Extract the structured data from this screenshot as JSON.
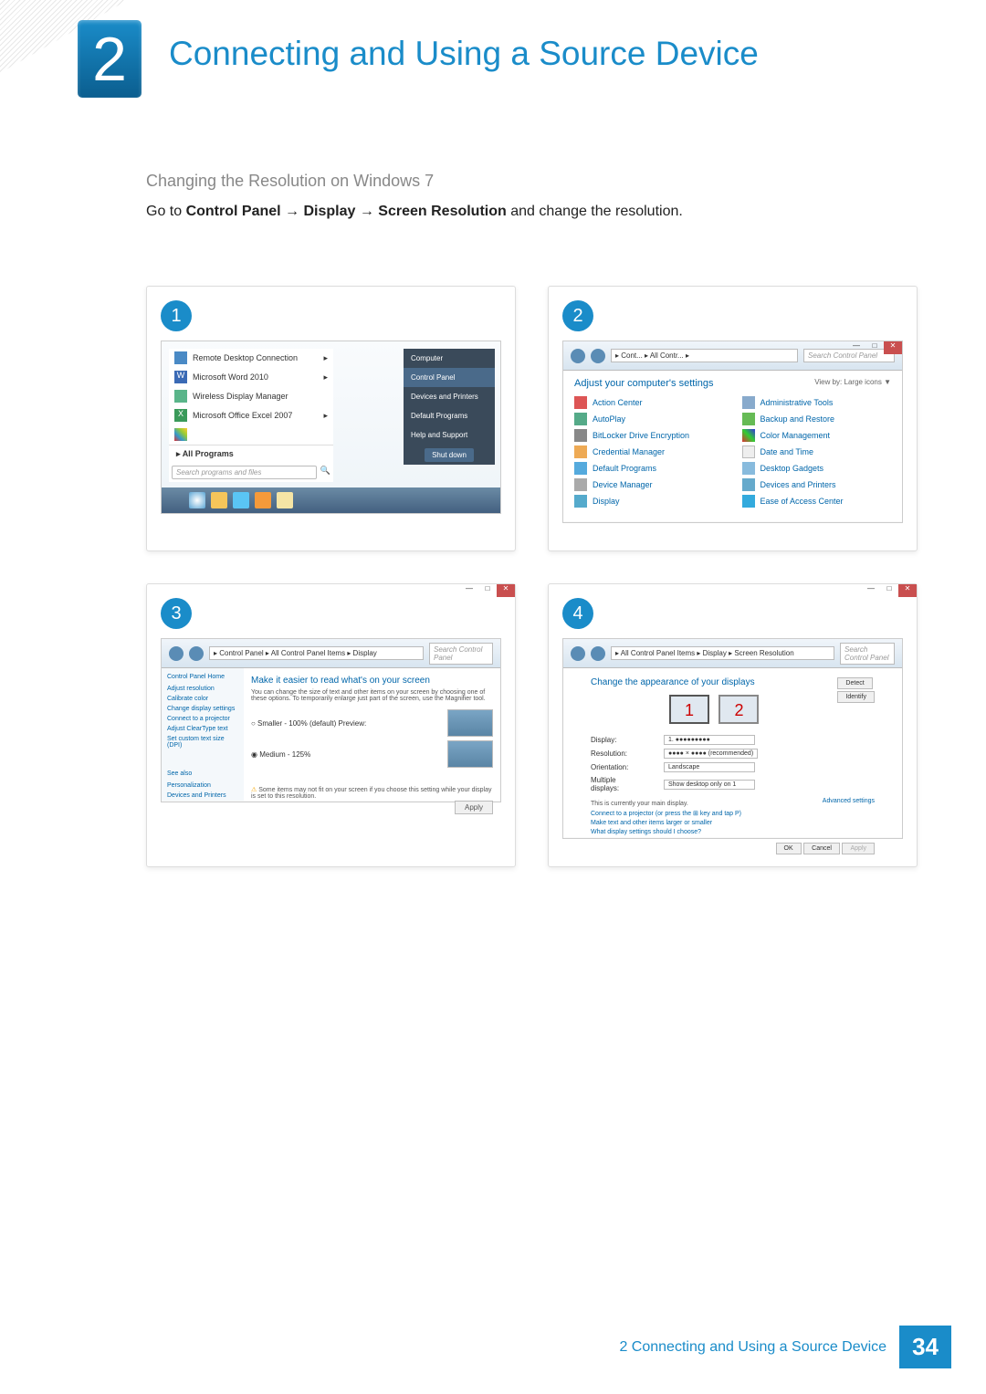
{
  "chapter": {
    "number": "2",
    "title": "Connecting and Using a Source Device"
  },
  "subsection": "Changing the Resolution on Windows 7",
  "instruction": {
    "prefix": "Go to ",
    "bold1": "Control Panel",
    "arrow1": " → ",
    "bold2": "Display",
    "arrow2": " → ",
    "bold3": "Screen Resolution",
    "suffix": " and change the resolution."
  },
  "screenshots": {
    "step1": {
      "label": "1",
      "programs": [
        "Remote Desktop Connection",
        "Microsoft Word 2010",
        "Wireless Display Manager",
        "Microsoft Office Excel 2007"
      ],
      "rightMenu": [
        "Computer",
        "Control Panel",
        "Devices and Printers",
        "Default Programs",
        "Help and Support"
      ],
      "allPrograms": "All Programs",
      "searchPlaceholder": "Search programs and files",
      "shutdown": "Shut down"
    },
    "step2": {
      "label": "2",
      "breadcrumb": "▸ Cont... ▸ All Contr... ▸",
      "searchPlaceholder": "Search Control Panel",
      "title": "Adjust your computer's settings",
      "viewBy": "View by:   Large icons ▼",
      "items": [
        "Action Center",
        "Administrative Tools",
        "AutoPlay",
        "Backup and Restore",
        "BitLocker Drive Encryption",
        "Color Management",
        "Credential Manager",
        "Date and Time",
        "Default Programs",
        "Desktop Gadgets",
        "Device Manager",
        "Devices and Printers",
        "Display",
        "Ease of Access Center"
      ]
    },
    "step3": {
      "label": "3",
      "breadcrumb": "▸ Control Panel ▸ All Control Panel Items ▸ Display",
      "searchPlaceholder": "Search Control Panel",
      "sidebar": {
        "head": "Control Panel Home",
        "links": [
          "Adjust resolution",
          "Calibrate color",
          "Change display settings",
          "Connect to a projector",
          "Adjust ClearType text",
          "Set custom text size (DPI)"
        ],
        "seeAlso": "See also",
        "bottom": [
          "Personalization",
          "Devices and Printers"
        ]
      },
      "main": {
        "title": "Make it easier to read what's on your screen",
        "text": "You can change the size of text and other items on your screen by choosing one of these options. To temporarily enlarge just part of the screen, use the Magnifier tool.",
        "option1": "○ Smaller - 100% (default)    Preview:",
        "option2": "◉ Medium - 125%",
        "warning": "Some items may not fit on your screen if you choose this setting while your display is set to this resolution.",
        "apply": "Apply"
      }
    },
    "step4": {
      "label": "4",
      "breadcrumb": "▸ All Control Panel Items ▸ Display ▸ Screen Resolution",
      "searchPlaceholder": "Search Control Panel",
      "title": "Change the appearance of your displays",
      "detect": "Detect",
      "identify": "Identify",
      "monitors": [
        "1",
        "2"
      ],
      "rows": {
        "display": {
          "label": "Display:",
          "value": "1. ●●●●●●●●●"
        },
        "resolution": {
          "label": "Resolution:",
          "value": "●●●● × ●●●● (recommended)"
        },
        "orientation": {
          "label": "Orientation:",
          "value": "Landscape"
        },
        "multiple": {
          "label": "Multiple displays:",
          "value": "Show desktop only on 1"
        }
      },
      "mainDisplay": "This is currently your main display.",
      "advanced": "Advanced settings",
      "connect": "Connect to a projector (or press the ⊞ key and tap P)",
      "makeLarger": "Make text and other items larger or smaller",
      "whatSettings": "What display settings should I choose?",
      "ok": "OK",
      "cancel": "Cancel",
      "applyBtn": "Apply"
    }
  },
  "footer": {
    "text": "2 Connecting and Using a Source Device",
    "page": "34"
  }
}
